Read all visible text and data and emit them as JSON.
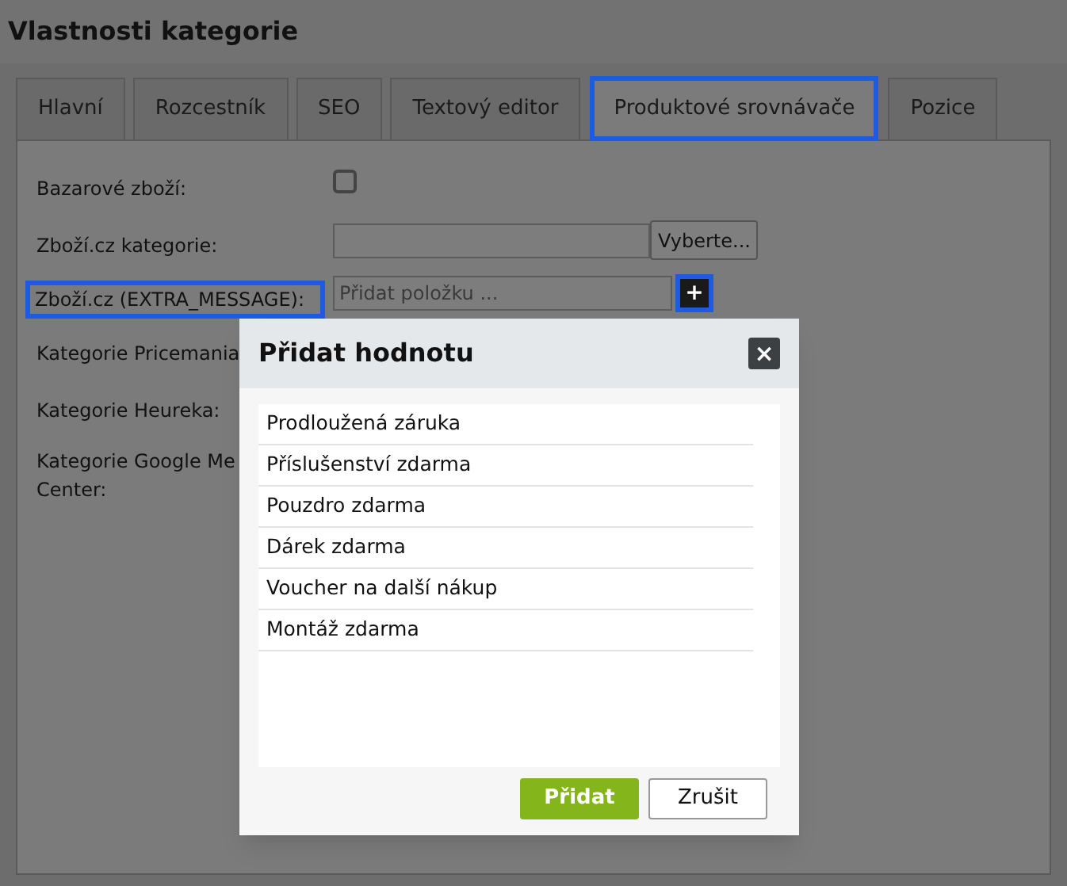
{
  "title": "Vlastnosti kategorie",
  "tabs": [
    {
      "label": "Hlavní",
      "selected": false,
      "highlighted": false
    },
    {
      "label": "Rozcestník",
      "selected": false,
      "highlighted": false
    },
    {
      "label": "SEO",
      "selected": false,
      "highlighted": false
    },
    {
      "label": "Textový editor",
      "selected": false,
      "highlighted": false
    },
    {
      "label": "Produktové srovnávače",
      "selected": true,
      "highlighted": true
    },
    {
      "label": "Pozice",
      "selected": false,
      "highlighted": false
    }
  ],
  "fields": [
    {
      "kind": "checkbox",
      "lines": [
        "Bazarové zboží:"
      ],
      "checked": false,
      "highlighted": false
    },
    {
      "kind": "picker",
      "lines": [
        "Zboží.cz kategorie:"
      ],
      "button": "Vyberte...",
      "highlighted": false
    },
    {
      "kind": "adder",
      "lines": [
        "Zboží.cz (EXTRA_MESSAGE):"
      ],
      "placeholder": "Přidat položku ...",
      "button": "+",
      "highlighted": true
    },
    {
      "kind": "plain",
      "lines": [
        "Kategorie Pricemania"
      ],
      "highlighted": false
    },
    {
      "kind": "plain",
      "lines": [
        "Kategorie Heureka:"
      ],
      "highlighted": false
    },
    {
      "kind": "plain",
      "lines": [
        "Kategorie Google Me",
        "Center:"
      ],
      "highlighted": false
    }
  ],
  "dialog": {
    "title": "Přidat hodnotu",
    "close": "×",
    "items": [
      "Prodloužená záruka",
      "Příslušenství zdarma",
      "Pouzdro zdarma",
      "Dárek zdarma",
      "Voucher na další nákup",
      "Montáž zdarma"
    ],
    "ok": "Přidat",
    "cancel": "Zrušit"
  }
}
